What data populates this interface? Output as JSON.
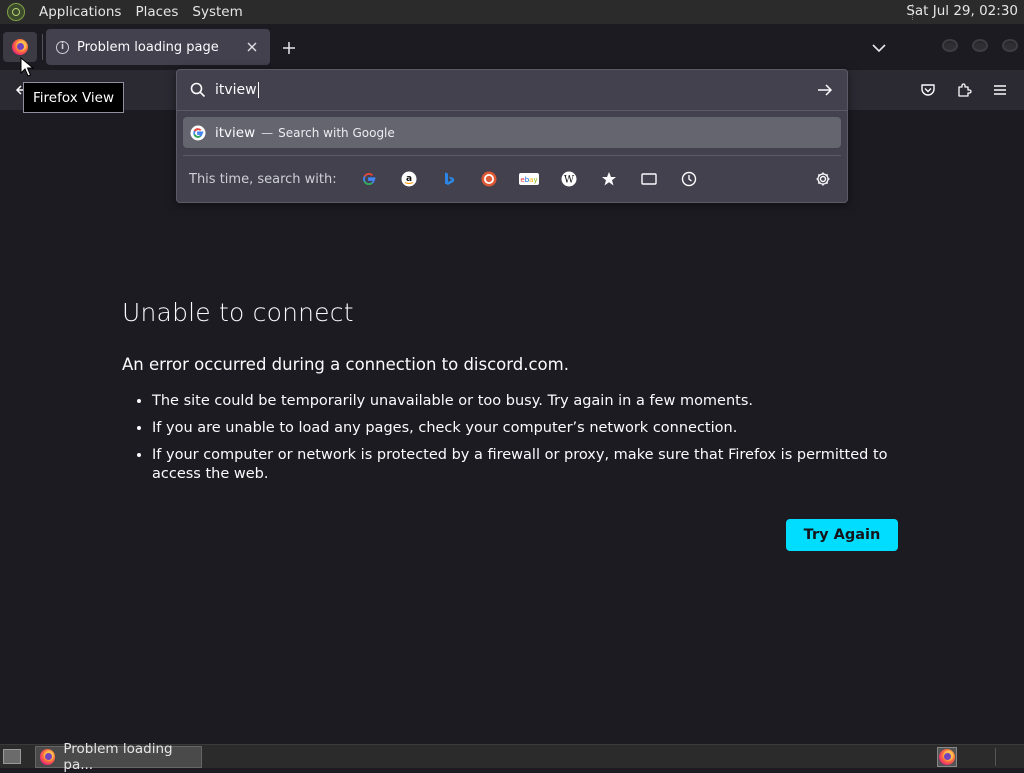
{
  "system_panel": {
    "menus": [
      "Applications",
      "Places",
      "System"
    ],
    "clock": "Sat Jul 29, 02:30"
  },
  "tabbar": {
    "firefox_view_tooltip": "Firefox View",
    "active_tab_title": "Problem loading page"
  },
  "urlbar": {
    "query": "itview",
    "suggestion": {
      "query": "itview",
      "separator": "—",
      "action": "Search with Google"
    },
    "oneoff_label": "This time, search with:",
    "engines": [
      "google-icon",
      "amazon-icon",
      "bing-icon",
      "duckduckgo-icon",
      "ebay-icon",
      "wikipedia-icon",
      "bookmarks-icon",
      "tabs-icon",
      "history-icon"
    ]
  },
  "error_page": {
    "title": "Unable to connect",
    "description": "An error occurred during a connection to discord.com.",
    "items": [
      "The site could be temporarily unavailable or too busy. Try again in a few moments.",
      "If you are unable to load any pages, check your computer’s network connection.",
      "If your computer or network is protected by a firewall or proxy, make sure that Firefox is permitted to access the web."
    ],
    "try_again_label": "Try Again"
  },
  "taskbar": {
    "task_label": "Problem loading pa..."
  },
  "colors": {
    "page_background": "#1c1b22",
    "accent_button": "#00ddff",
    "suggestion_highlight": "#65656f"
  }
}
